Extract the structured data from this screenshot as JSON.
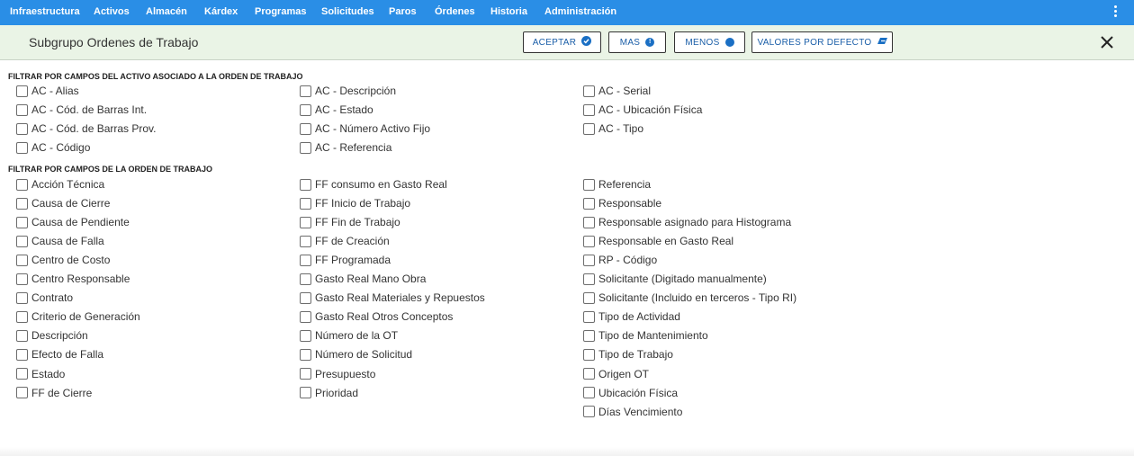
{
  "nav": {
    "items": [
      "Infraestructura",
      "Activos",
      "Almacén",
      "Kárdex",
      "Programas",
      "Solicitudes",
      "Paros",
      "Órdenes",
      "Historia",
      "Administración"
    ]
  },
  "header": {
    "title": "Subgrupo Ordenes de Trabajo",
    "buttons": {
      "aceptar": "ACEPTAR",
      "mas": "MAS",
      "menos": "MENOS",
      "defecto": "VALORES POR DEFECTO"
    }
  },
  "section1": {
    "title": "FILTRAR POR CAMPOS DEL ACTIVO ASOCIADO A LA ORDEN DE TRABAJO",
    "col1": [
      "AC - Alias",
      "AC - Cód. de Barras Int.",
      "AC - Cód. de Barras Prov.",
      "AC - Código"
    ],
    "col2": [
      "AC - Descripción",
      "AC - Estado",
      "AC - Número Activo Fijo",
      "AC - Referencia"
    ],
    "col3": [
      "AC - Serial",
      "AC - Ubicación Física",
      "AC - Tipo"
    ]
  },
  "section2": {
    "title": "FILTRAR POR CAMPOS DE LA ORDEN DE TRABAJO",
    "col1": [
      "Acción Técnica",
      "Causa de Cierre",
      "Causa de Pendiente",
      "Causa de Falla",
      "Centro de Costo",
      "Centro Responsable",
      "Contrato",
      "Criterio de Generación",
      "Descripción",
      "Efecto de Falla",
      "Estado",
      "FF de Cierre"
    ],
    "col2": [
      "FF consumo en Gasto Real",
      "FF Inicio de Trabajo",
      "FF Fin de Trabajo",
      "FF de Creación",
      "FF Programada",
      "Gasto Real Mano Obra",
      "Gasto Real Materiales y Repuestos",
      "Gasto Real Otros Conceptos",
      "Número de la OT",
      "Número de Solicitud",
      "Presupuesto",
      "Prioridad"
    ],
    "col3": [
      "Referencia",
      "Responsable",
      "Responsable asignado para Histograma",
      "Responsable en Gasto Real",
      "RP - Código",
      "Solicitante (Digitado manualmente)",
      "Solicitante (Incluido en terceros - Tipo RI)",
      "Tipo de Actividad",
      "Tipo de Mantenimiento",
      "Tipo de Trabajo",
      "Origen OT",
      "Ubicación Física",
      "Días Vencimiento"
    ]
  },
  "icons": {
    "aceptar": "check-circle-icon",
    "mas": "info-circle-icon",
    "menos": "circle-icon",
    "defecto": "eraser-icon",
    "close": "close-icon",
    "menu": "kebab-menu-icon"
  },
  "colors": {
    "nav_bg": "#2a8ee6",
    "header_bg": "#eaf4e6",
    "button_text": "#1a5ea8"
  }
}
